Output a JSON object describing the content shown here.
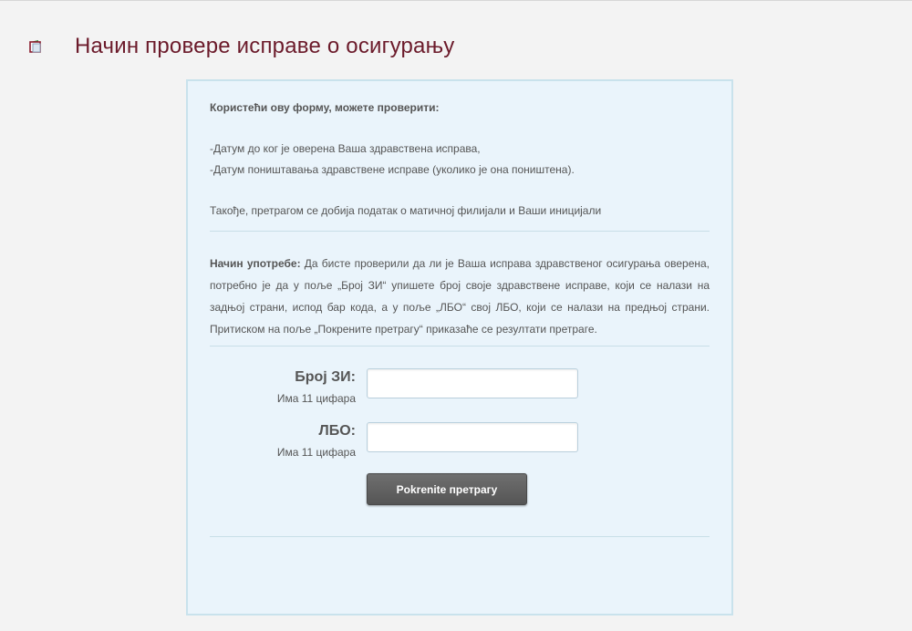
{
  "header": {
    "title": "Начин провере исправе о осигурању",
    "icon": "document-icon"
  },
  "intro": {
    "heading": "Користећи ову форму, можете проверити:",
    "items": [
      "-Датум до ког је оверена Ваша здравствена исправа,",
      "-Датум поништавања здравствене исправе (уколико је она поништена)."
    ],
    "note": "Такође, претрагом се добија податак о матичној филијали и Ваши иницијали"
  },
  "usage": {
    "label": "Начин употребе:",
    "text": "Да бисте проверили да ли је Ваша исправа здравственог осигурања оверена, потребно је да у поље „Број ЗИ“ упишете број своје здравствене исправе, који се налази на задњој страни, испод бар кода,  а у поље „ЛБО“ свој ЛБО, који се налази на предњој страни. Притиском на поље „Покрените претрагу“ приказаће се резултати претраге."
  },
  "form": {
    "zi_label": "Број ЗИ:",
    "zi_hint": "Има 11 цифара",
    "zi_value": "",
    "lbo_label": "ЛБО:",
    "lbo_hint": "Има 11 цифара",
    "lbo_value": "",
    "submit_label": "Pokrenite претрагу"
  },
  "colors": {
    "title": "#6b1a2a",
    "panel_bg": "#eaf4fb",
    "panel_border": "#c9e2ec",
    "button_bg": "#5f5f5f"
  }
}
